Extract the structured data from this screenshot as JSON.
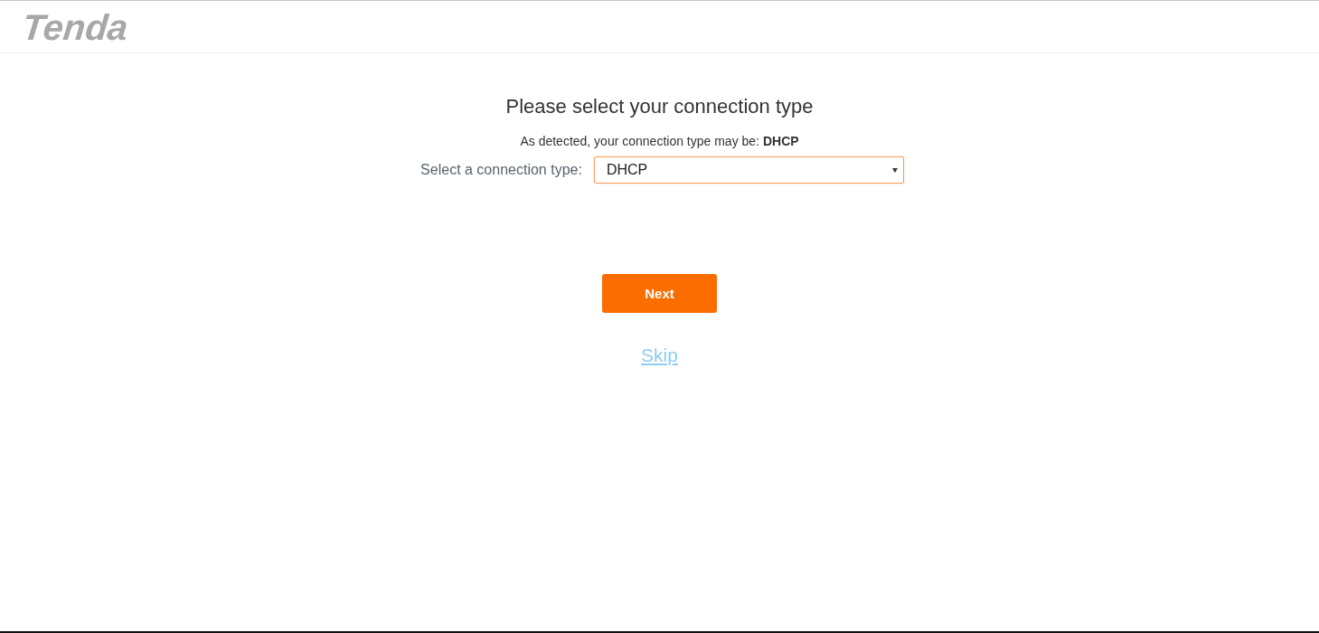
{
  "header": {
    "logo": "Tenda"
  },
  "title": "Please select your connection type",
  "detected": "As detected, your connection type may be: **DHCP**",
  "connection_type": {
    "label": "Select a connection type:",
    "value": "DHCP"
  },
  "next_button": "Next",
  "skip_link": "Skip"
}
